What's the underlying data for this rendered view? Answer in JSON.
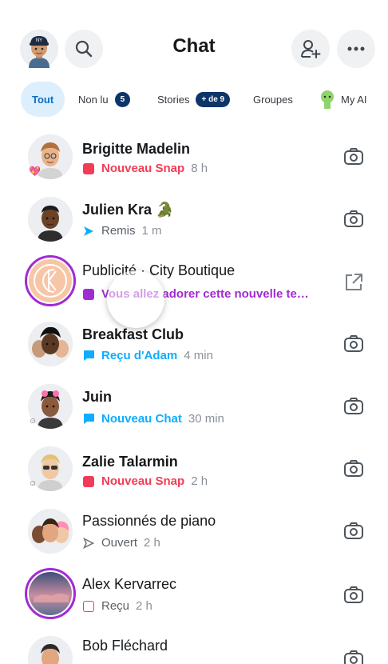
{
  "header": {
    "title": "Chat",
    "profile_icon": "bitmoji-avatar",
    "search_icon": "search-icon",
    "add_friend_icon": "add-friend-icon",
    "more_icon": "more-icon"
  },
  "filters": [
    {
      "label": "Tout",
      "active": true
    },
    {
      "label": "Non lu",
      "badge": "5"
    },
    {
      "label": "Stories",
      "badge": "+ de 9"
    },
    {
      "label": "Groupes"
    },
    {
      "label": "My AI"
    }
  ],
  "chats": [
    {
      "name": "Brigitte Madelin",
      "status": "Nouveau Snap",
      "time": "8 h",
      "status_color": "#f23c57",
      "indicator": "filled-square",
      "action": "camera-icon"
    },
    {
      "name": "Julien Kra",
      "name_emoji": "🐊",
      "status": "Remis",
      "time": "1 m",
      "status_color": "#5a6169",
      "indicator": "sent-arrow",
      "action": "camera-icon"
    },
    {
      "name": "Publicité · City Boutique",
      "status": "Vous allez adorer cette nouvelle te…",
      "time": "",
      "status_color": "#a12bd3",
      "indicator": "filled-square-purple",
      "action": "external-link-icon"
    },
    {
      "name": "Breakfast Club",
      "status": "Reçu d'Adam",
      "time": "4 min",
      "status_color": "#0eadff",
      "indicator": "chat-bubble-filled",
      "action": "camera-icon"
    },
    {
      "name": "Juin",
      "status": "Nouveau Chat",
      "time": "30 min",
      "status_color": "#0eadff",
      "indicator": "chat-bubble-filled",
      "action": "camera-icon"
    },
    {
      "name": "Zalie Talarmin",
      "status": "Nouveau Snap",
      "time": "2 h",
      "status_color": "#f23c57",
      "indicator": "filled-square",
      "action": "camera-icon"
    },
    {
      "name": "Passionnés de piano",
      "status": "Ouvert",
      "time": "2 h",
      "status_color": "#5a6169",
      "indicator": "opened-arrow",
      "action": "camera-icon"
    },
    {
      "name": "Alex Kervarrec",
      "status": "Reçu",
      "time": "2 h",
      "status_color": "#5a6169",
      "indicator": "empty-square-red",
      "action": "camera-icon"
    },
    {
      "name": "Bob Fléchard",
      "status": "",
      "time": "",
      "status_color": "#5a6169",
      "indicator": "",
      "action": "camera-icon"
    }
  ]
}
